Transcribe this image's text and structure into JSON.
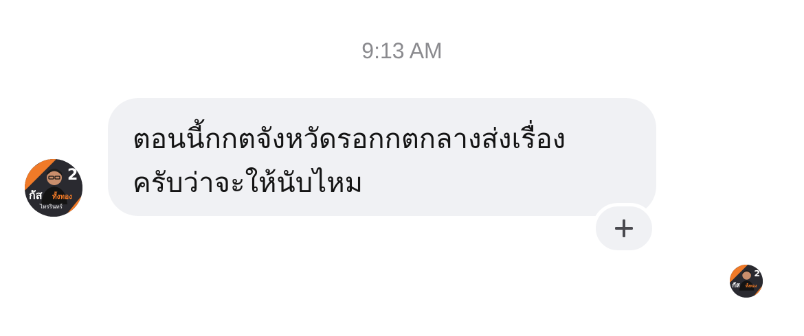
{
  "timestamp": "9:13 AM",
  "message": {
    "text": "ตอนนี้กกตจังหวัดรอกกตกลางส่งเรื่อง\nครับว่าจะให้นับไหม"
  },
  "avatar": {
    "number": "2",
    "name": "กัส",
    "surname": "ทั้งทอง",
    "subtitle": "ไทรรินทร์"
  },
  "reaction_button": {
    "icon": "plus-icon"
  },
  "colors": {
    "bubble": "#f0f1f4",
    "timestamp": "#8a8a8e",
    "text": "#141414",
    "accent_orange": "#f07a28"
  }
}
